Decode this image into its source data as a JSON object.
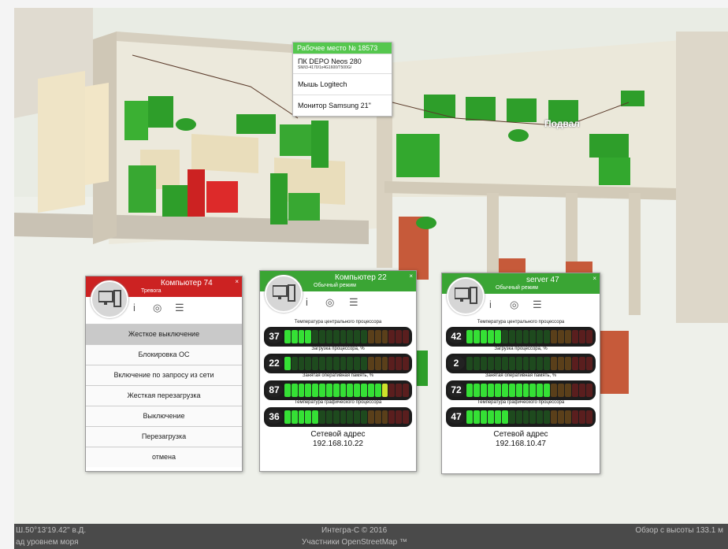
{
  "scene": {
    "basement_label": "Подвал"
  },
  "tooltip": {
    "title": "Рабочее место № 18573",
    "pc_name": "ПК DEPO Neos 280",
    "pc_spec": "SM/i3-4170/1x4G1600/T500G/",
    "mouse": "Мышь Logitech",
    "monitor": "Монитор Samsung 21\""
  },
  "panels": [
    {
      "title": "Компьютер 74",
      "subtitle": "Тревога",
      "close": "×",
      "status_color": "#cc2222",
      "icons": [
        "info-icon",
        "webcam-icon",
        "menu-icon"
      ],
      "icon_glyphs": {
        "info": "i",
        "webcam": "◎",
        "menu": "☰"
      },
      "menu": [
        "Жесткое выключение",
        "Блокировка ОС",
        "Включение по запросу из сети",
        "Жесткая перезагрузка",
        "Выключение",
        "Перезагрузка",
        "отмена"
      ]
    },
    {
      "title": "Компьютер 22",
      "subtitle": "Обычный режим",
      "close": "×",
      "status_color": "#3aa534",
      "icon_glyphs": {
        "info": "i",
        "webcam": "◎",
        "menu": "☰"
      },
      "gauges": [
        {
          "label": "Температура центрального процессора",
          "value": 37,
          "lit": 4
        },
        {
          "label": "Загрузка процессора, %",
          "value": 22,
          "lit": 1
        },
        {
          "label": "Занятая оперативная память, %",
          "value": 87,
          "lit": 15
        },
        {
          "label": "Температура графического процессора",
          "value": 36,
          "lit": 5
        }
      ],
      "addr_label": "Сетевой адрес",
      "addr": "192.168.10.22"
    },
    {
      "title": "server 47",
      "subtitle": "Обычный режим",
      "close": "×",
      "status_color": "#3aa534",
      "icon_glyphs": {
        "info": "i",
        "webcam": "◎",
        "menu": "☰"
      },
      "gauges": [
        {
          "label": "Температура центрального процессора",
          "value": 42,
          "lit": 5
        },
        {
          "label": "Загрузка процессора, %",
          "value": 2,
          "lit": 0
        },
        {
          "label": "Занятая оперативная память, %",
          "value": 72,
          "lit": 12
        },
        {
          "label": "Температура графического процессора",
          "value": 47,
          "lit": 6
        }
      ],
      "addr_label": "Сетевой адрес",
      "addr": "192.168.10.47"
    }
  ],
  "status_bar": {
    "coords_line1": "Ш.50°13'19.42\" в.Д.",
    "coords_line2": "ад уровнем моря",
    "credit_line1": "Интегра-С © 2016",
    "credit_line2": "Участники OpenStreetMap ™",
    "altitude": "Обзор с высоты 133.1 м"
  }
}
